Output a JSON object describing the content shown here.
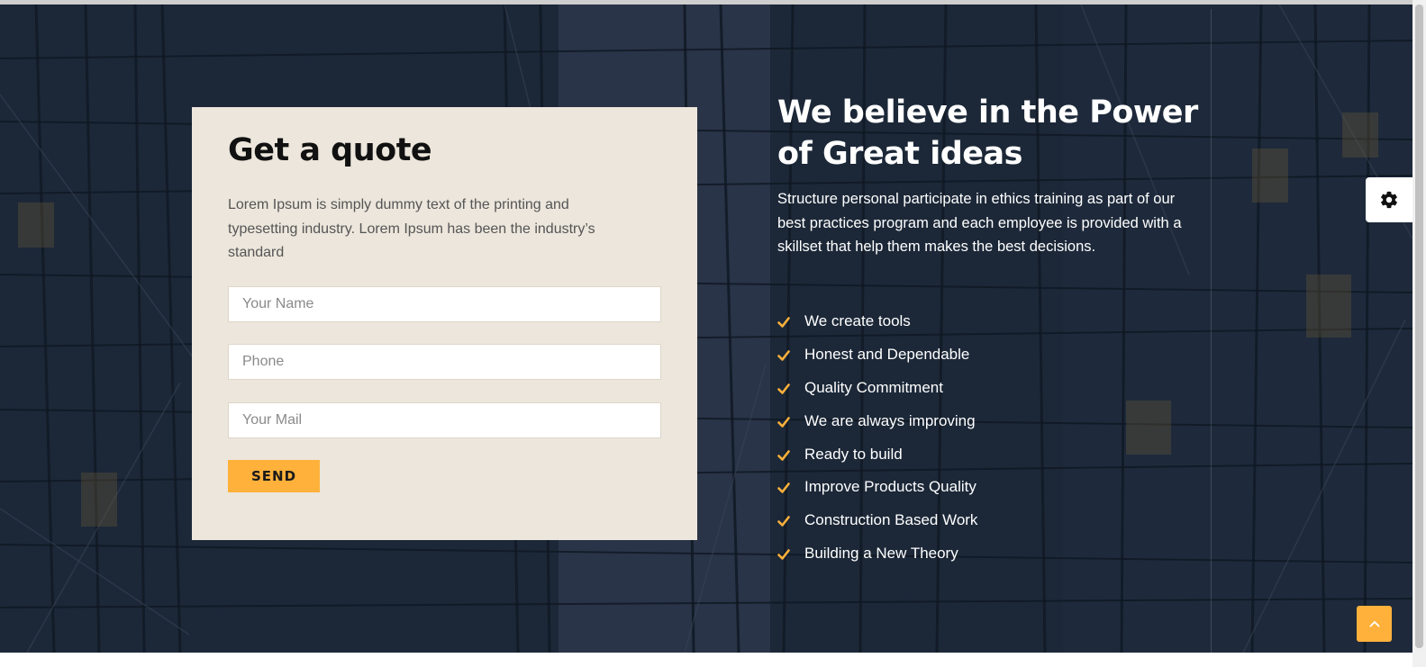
{
  "quote": {
    "title": "Get a quote",
    "description": "Lorem Ipsum is simply dummy text of the printing and typesetting industry. Lorem Ipsum has been the industry’s standard",
    "name_placeholder": "Your Name",
    "phone_placeholder": "Phone",
    "mail_placeholder": "Your Mail",
    "send_label": "SEND"
  },
  "about": {
    "title": "We believe in the Power of Great ideas",
    "description": "Structure personal participate in ethics training as part of our best practices program and each employee is provided with a skillset that help them makes the best decisions.",
    "features": [
      "We create tools",
      "Honest and Dependable",
      "Quality Commitment",
      "We are always improving",
      "Ready to build",
      "Improve Products Quality",
      "Construction Based Work",
      "Building a New Theory"
    ]
  },
  "icons": {
    "check": "check-icon",
    "settings": "gear-icon",
    "scroll_top": "chevron-up-icon"
  },
  "colors": {
    "accent": "#ffb13b",
    "background": "#1d2a3c",
    "card": "#ece6dc"
  }
}
